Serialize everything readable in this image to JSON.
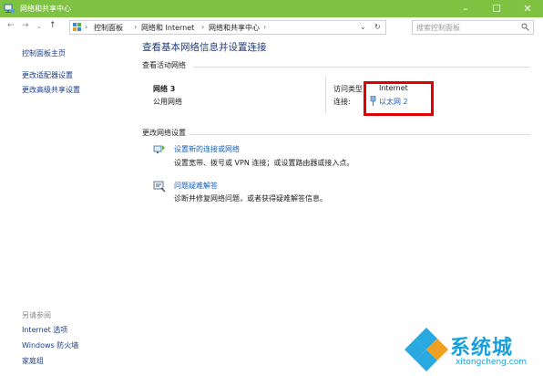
{
  "window": {
    "title": "网络和共享中心"
  },
  "colors": {
    "titlebar": "#7fc241",
    "link": "#1a5fb4",
    "highlight_box": "#e00000"
  },
  "addressbar": {
    "crumbs": [
      "控制面板",
      "网络和 Internet",
      "网络和共享中心"
    ],
    "search_placeholder": "搜索控制面板"
  },
  "sidebar": {
    "items": [
      "控制面板主页",
      "更改适配器设置",
      "更改高级共享设置"
    ],
    "see_also_heading": "另请参阅",
    "see_also": [
      "Internet 选项",
      "Windows 防火墙",
      "家庭组"
    ]
  },
  "main": {
    "title": "查看基本网络信息并设置连接",
    "active_networks_heading": "查看活动网络",
    "network_name": "网络 3",
    "network_type": "公用网络",
    "access_type_label": "访问类型：",
    "access_type_value": "Internet",
    "connection_label": "连接:",
    "connection_value": "以太网 2",
    "change_settings_heading": "更改网络设置",
    "actions": [
      {
        "title": "设置新的连接或网络",
        "desc": "设置宽带、拨号或 VPN 连接；或设置路由器或接入点。",
        "icon": "network-setup-icon"
      },
      {
        "title": "问题疑难解答",
        "desc": "诊断并修复网络问题，或者获得疑难解答信息。",
        "icon": "troubleshoot-icon"
      }
    ]
  },
  "watermark": {
    "brand": "系统城",
    "url": "xitongcheng.com"
  }
}
